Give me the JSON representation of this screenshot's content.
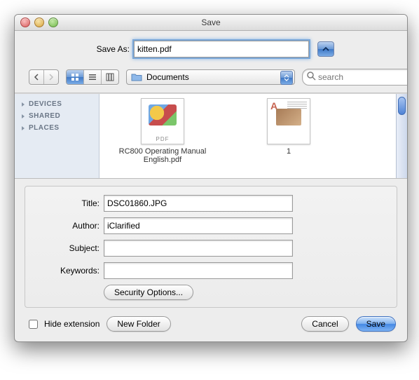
{
  "window": {
    "title": "Save"
  },
  "saveas": {
    "label": "Save As:",
    "filename": "kitten.pdf"
  },
  "path": {
    "folder": "Documents"
  },
  "search": {
    "placeholder": "search"
  },
  "sidebar": {
    "items": [
      {
        "label": "DEVICES"
      },
      {
        "label": "SHARED"
      },
      {
        "label": "PLACES"
      }
    ]
  },
  "files": [
    {
      "name": "RC800 Operating Manual English.pdf",
      "badge": "PDF"
    },
    {
      "name": "1",
      "badge": ""
    }
  ],
  "meta": {
    "title_label": "Title:",
    "title_value": "DSC01860.JPG",
    "author_label": "Author:",
    "author_value": "iClarified",
    "subject_label": "Subject:",
    "subject_value": "",
    "keywords_label": "Keywords:",
    "keywords_value": "",
    "security_label": "Security Options..."
  },
  "footer": {
    "hide_ext_label": "Hide extension",
    "new_folder_label": "New Folder",
    "cancel_label": "Cancel",
    "save_label": "Save"
  }
}
